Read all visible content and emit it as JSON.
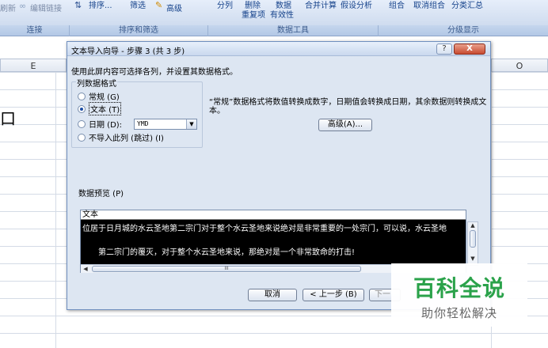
{
  "ribbon": {
    "left_partial": "刷新",
    "edit_links": "编辑链接",
    "sort": "排序...",
    "filter": "筛选",
    "advanced": "高级",
    "split_columns": "分列",
    "remove_dupes": "删除",
    "dupes_line2": "重复项",
    "data_top": "数据",
    "validity": "有效性",
    "consolidate": "合并计算",
    "whatif": "假设分析",
    "group": "组合",
    "ungroup": "取消组合",
    "subtotal": "分类汇总",
    "groups": [
      "连接",
      "排序和筛选",
      "数据工具",
      "分级显示"
    ]
  },
  "sheet": {
    "columns": [
      "E",
      "O"
    ],
    "cell_text": "口"
  },
  "dialog": {
    "title": "文本导入向导 - 步骤 3 (共 3 步)",
    "help": "?",
    "close": "X",
    "instruction": "使用此屏内容可选择各列，并设置其数据格式。",
    "format_legend": "列数据格式",
    "options": [
      "常规 (G)",
      "文本 (T)",
      "日期 (D):",
      "不导入此列 (跳过) (I)"
    ],
    "date_format": "YMD",
    "description": "“常规”数据格式将数值转换成数字，日期值会转换成日期，其余数据则转换成文本。",
    "advanced_button": "高级(A)...",
    "preview_label": "数据预览 (P)",
    "preview_header": "文本",
    "preview_rows": [
      "位居于日月城的水云圣地第二宗门对于整个水云圣地来说绝对是非常重要的一处宗门，可以说，水云圣地",
      "第二宗门的覆灭，对于整个水云圣地来说，那绝对是一个非常致命的打击!"
    ],
    "scroll_mid": "III",
    "cancel": "取消",
    "back": "< 上一步 (B)",
    "next_partial": "下一"
  },
  "watermark": {
    "main": "百科全说",
    "sub": "助你轻松解决"
  }
}
